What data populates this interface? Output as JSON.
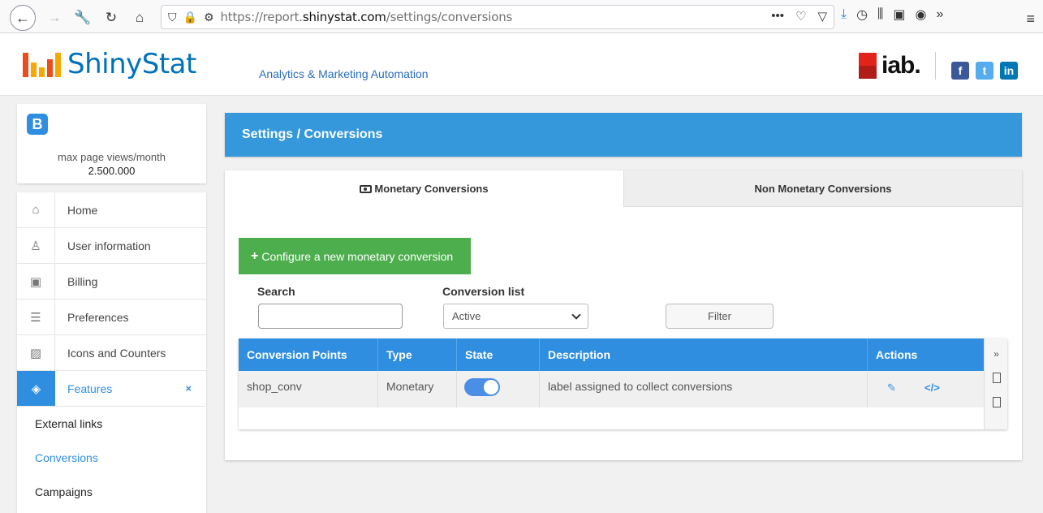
{
  "browser": {
    "url_prefix": "https://report.",
    "url_domain": "shinystat.com",
    "url_path": "/settings/conversions"
  },
  "header": {
    "brand": "ShinyStat",
    "tagline": "Analytics & Marketing Automation",
    "partner": "iab.",
    "social": [
      "f",
      "t",
      "in"
    ],
    "brand_colors": [
      "#e94e1b",
      "#f7a800",
      "#0072bc"
    ]
  },
  "plan": {
    "badge": "B",
    "label": "max page views/month",
    "value": "2.500.000"
  },
  "sidebar": {
    "items": [
      {
        "label": "Home",
        "icon": "home-icon"
      },
      {
        "label": "User information",
        "icon": "user-icon"
      },
      {
        "label": "Billing",
        "icon": "money-icon"
      },
      {
        "label": "Preferences",
        "icon": "sliders-icon"
      },
      {
        "label": "Icons and Counters",
        "icon": "image-icon"
      },
      {
        "label": "Features",
        "icon": "layers-icon",
        "close": "×"
      }
    ],
    "subitems": [
      "External links",
      "Conversions",
      "Campaigns"
    ]
  },
  "main": {
    "title": "Settings / Conversions",
    "tabs": [
      "Monetary Conversions",
      "Non Monetary Conversions"
    ],
    "new_button": "Configure a new monetary conversion",
    "search_label": "Search",
    "search_value": "",
    "conv_list_label": "Conversion list",
    "conv_list_selected": "Active",
    "filter_button": "Filter",
    "table": {
      "headers": [
        "Conversion Points",
        "Type",
        "State",
        "Description",
        "Actions"
      ],
      "rows": [
        {
          "point": "shop_conv",
          "type": "Monetary",
          "state": "on",
          "description": "label assigned to collect conversions"
        }
      ]
    },
    "accent": "#2f8ee0",
    "button_green": "#4cae4c"
  }
}
